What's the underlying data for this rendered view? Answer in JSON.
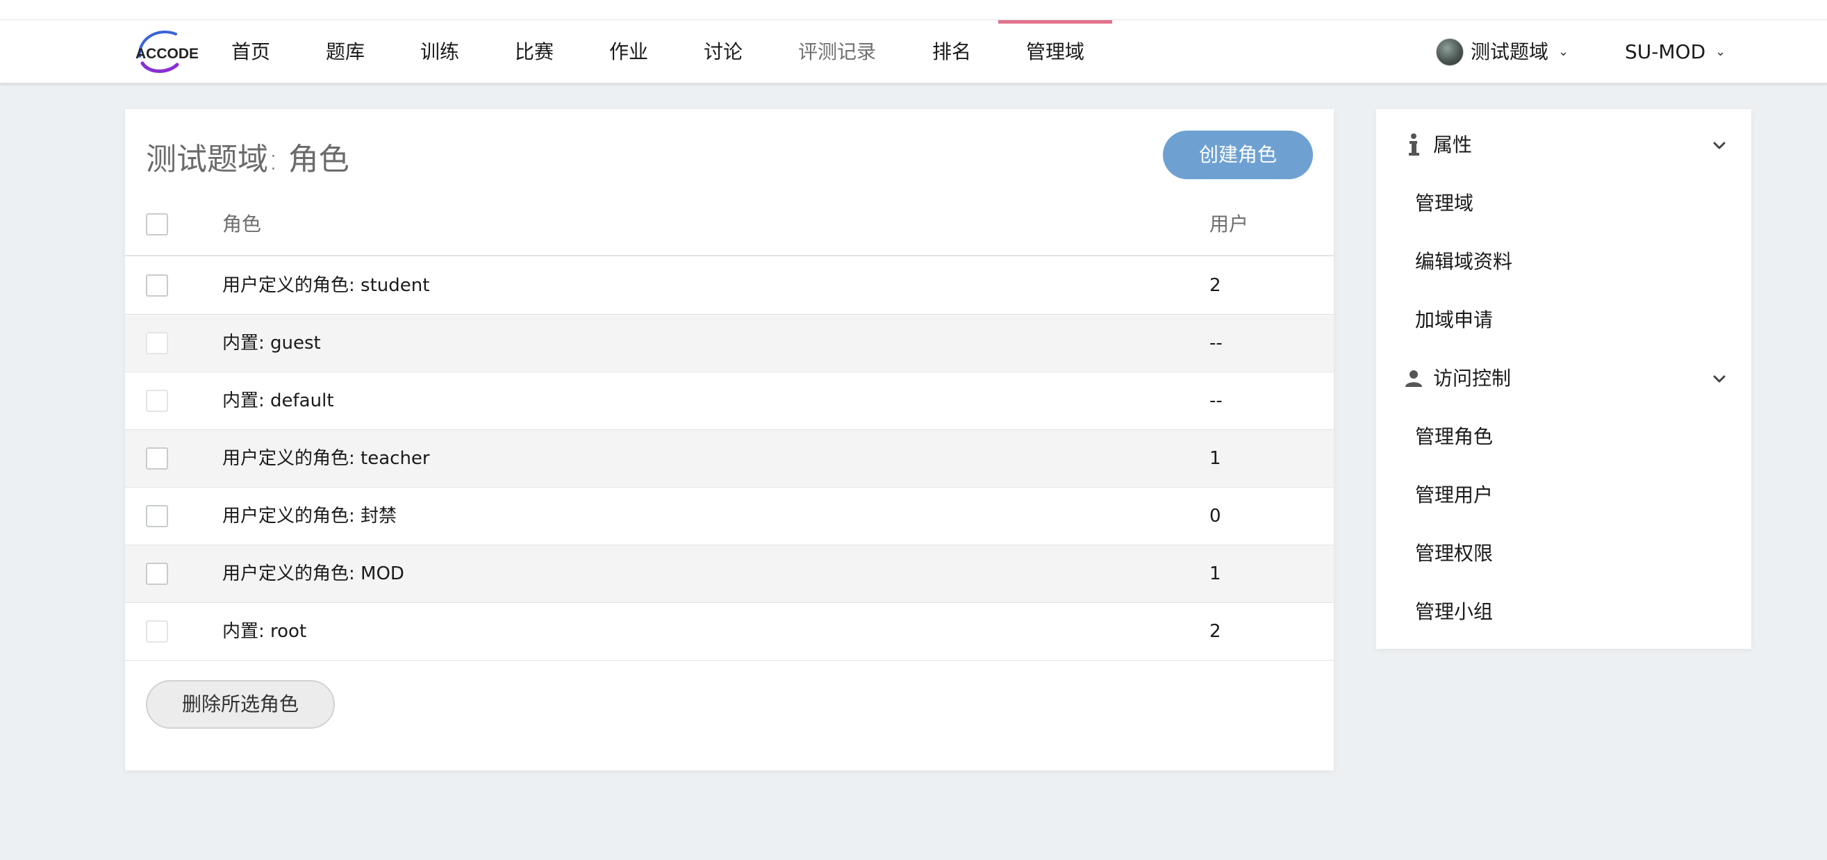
{
  "app": {
    "logo_text": "ACCODE"
  },
  "nav": {
    "items": [
      {
        "label": "首页"
      },
      {
        "label": "题库"
      },
      {
        "label": "训练"
      },
      {
        "label": "比赛"
      },
      {
        "label": "作业"
      },
      {
        "label": "讨论"
      },
      {
        "label": "评测记录"
      },
      {
        "label": "排名"
      },
      {
        "label": "管理域"
      }
    ],
    "active_item": "管理域",
    "active_color": "#e1728c",
    "domain_switch": "测试题域",
    "user_menu": "SU-MOD"
  },
  "main": {
    "title": "测试题域: 角色",
    "create_button": "创建角色",
    "columns": {
      "role": "角色",
      "users": "用户"
    },
    "rows": [
      {
        "role": "用户定义的角色: student",
        "users": "2",
        "checkbox_enabled": true
      },
      {
        "role": "内置: guest",
        "users": "--",
        "checkbox_enabled": false
      },
      {
        "role": "内置: default",
        "users": "--",
        "checkbox_enabled": false
      },
      {
        "role": "用户定义的角色: teacher",
        "users": "1",
        "checkbox_enabled": true
      },
      {
        "role": "用户定义的角色: 封禁",
        "users": "0",
        "checkbox_enabled": true
      },
      {
        "role": "用户定义的角色: MOD",
        "users": "1",
        "checkbox_enabled": true
      },
      {
        "role": "内置: root",
        "users": "2",
        "checkbox_enabled": false
      }
    ],
    "delete_button": "删除所选角色",
    "primary_color": "#6ea1d2"
  },
  "sidebar": {
    "sections": [
      {
        "label": "属性",
        "icon": "info-icon",
        "items": [
          "管理域",
          "编辑域资料",
          "加域申请"
        ]
      },
      {
        "label": "访问控制",
        "icon": "user-icon",
        "items": [
          "管理角色",
          "管理用户",
          "管理权限",
          "管理小组"
        ]
      }
    ]
  }
}
